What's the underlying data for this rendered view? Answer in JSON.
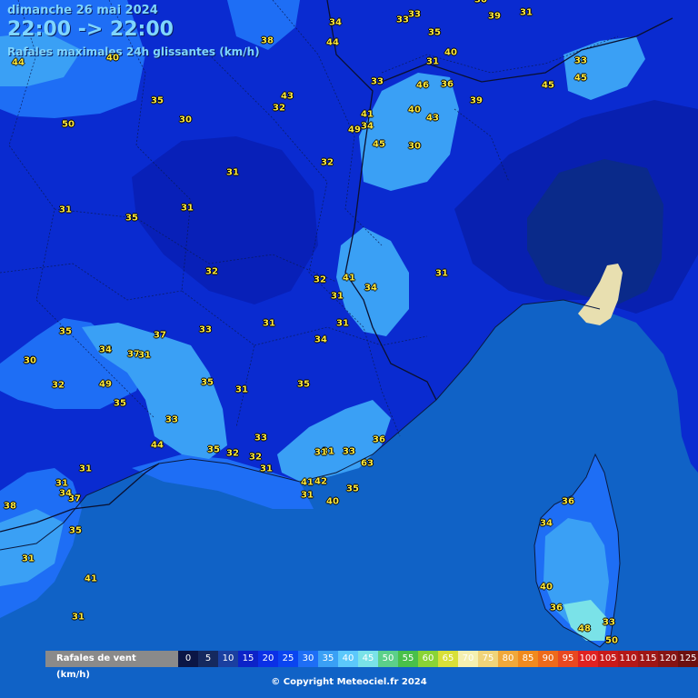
{
  "header": {
    "date": "dimanche 26 mai 2024",
    "time_range": "22:00 -> 22:00",
    "subtitle": "Rafales maximales 24h glissantes (km/h)"
  },
  "values": [
    "44",
    "40",
    "38",
    "34",
    "33",
    "33",
    "30",
    "39",
    "31",
    "44",
    "35",
    "40",
    "33",
    "45",
    "50",
    "35",
    "30",
    "43",
    "32",
    "33",
    "46",
    "36",
    "39",
    "31",
    "45",
    "41",
    "40",
    "43",
    "49",
    "34",
    "45",
    "30",
    "31",
    "32",
    "31",
    "35",
    "31",
    "31",
    "32",
    "41",
    "32",
    "34",
    "31",
    "31",
    "35",
    "32",
    "33",
    "31",
    "37",
    "37",
    "34",
    "34",
    "33",
    "31",
    "30",
    "49",
    "32",
    "35",
    "35",
    "35",
    "31",
    "33",
    "33",
    "31",
    "44",
    "35",
    "32",
    "32",
    "31",
    "36",
    "33",
    "31",
    "63",
    "31",
    "41",
    "42",
    "33",
    "31",
    "40",
    "35",
    "37",
    "38",
    "31",
    "34",
    "35",
    "31",
    "36",
    "34",
    "41",
    "40",
    "36",
    "31",
    "33",
    "48",
    "50"
  ],
  "legend": {
    "title": "Rafales de vent (km/h)",
    "items": [
      {
        "label": "0",
        "color": "#0b1645"
      },
      {
        "label": "5",
        "color": "#15295e"
      },
      {
        "label": "10",
        "color": "#1a3fa0"
      },
      {
        "label": "15",
        "color": "#0c23c8"
      },
      {
        "label": "20",
        "color": "#0b30e6"
      },
      {
        "label": "25",
        "color": "#0a45f0"
      },
      {
        "label": "30",
        "color": "#1e6ef5"
      },
      {
        "label": "35",
        "color": "#3aa0f5"
      },
      {
        "label": "40",
        "color": "#5cc8fb"
      },
      {
        "label": "45",
        "color": "#7ae2e8"
      },
      {
        "label": "50",
        "color": "#5cd08a"
      },
      {
        "label": "55",
        "color": "#49c04a"
      },
      {
        "label": "60",
        "color": "#8ad436"
      },
      {
        "label": "65",
        "color": "#d8e038"
      },
      {
        "label": "70",
        "color": "#f5f0b0"
      },
      {
        "label": "75",
        "color": "#f0d47a"
      },
      {
        "label": "80",
        "color": "#f0a83a"
      },
      {
        "label": "85",
        "color": "#f08a1e"
      },
      {
        "label": "90",
        "color": "#ee6a1a"
      },
      {
        "label": "95",
        "color": "#e84820"
      },
      {
        "label": "100",
        "color": "#e02222"
      },
      {
        "label": "105",
        "color": "#c81a1a"
      },
      {
        "label": "110",
        "color": "#b41818"
      },
      {
        "label": "115",
        "color": "#9e1616"
      },
      {
        "label": "120",
        "color": "#861414"
      },
      {
        "label": "125",
        "color": "#6c1010"
      }
    ]
  },
  "copyright": "© Copyright Meteociel.fr 2024"
}
